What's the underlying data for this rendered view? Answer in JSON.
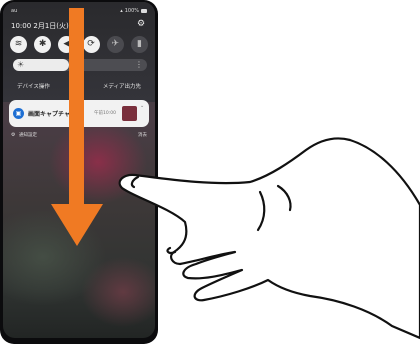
{
  "status_bar": {
    "carrier": "au",
    "right_text": "100%"
  },
  "shade": {
    "datetime": "10:00 2月1日(火)",
    "quick_settings": [
      {
        "icon": "wifi-icon",
        "glyph": "≋",
        "state": "on"
      },
      {
        "icon": "bluetooth-icon",
        "glyph": "✱",
        "state": "on"
      },
      {
        "icon": "sound-icon",
        "glyph": "◀",
        "state": "on"
      },
      {
        "icon": "rotate-icon",
        "glyph": "⟳",
        "state": "on"
      },
      {
        "icon": "airplane-icon",
        "glyph": "✈",
        "state": "off"
      },
      {
        "icon": "flashlight-icon",
        "glyph": "▮",
        "state": "off"
      }
    ],
    "brightness_level": 0.42,
    "tabs": {
      "device": "デバイス操作",
      "media": "メディア出力先"
    }
  },
  "notification": {
    "title": "画面キャプチャ",
    "time": "午前10:00"
  },
  "notification_footer": {
    "settings_label": "通知設定",
    "clear_label": "消去"
  },
  "colors": {
    "arrow": "#f07a23",
    "app_icon": "#1e6fd3"
  }
}
